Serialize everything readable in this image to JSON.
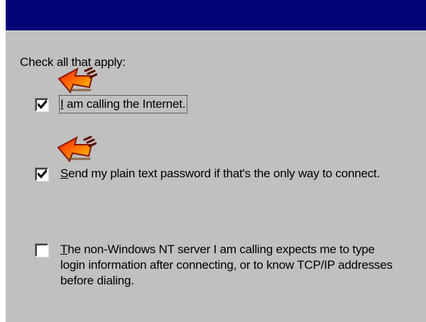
{
  "window": {
    "title_bar_color": "#040478",
    "panel_color": "#c0c0c0"
  },
  "dialog": {
    "instruction": "Check all that apply:",
    "options": [
      {
        "checked": true,
        "label_first": "I",
        "label_rest": " am calling the Internet.",
        "focused": true
      },
      {
        "checked": true,
        "label_first": "S",
        "label_rest": "end my plain text password if that's the only way to connect.",
        "focused": false
      },
      {
        "checked": false,
        "label_first": "T",
        "label_rest": "he non-Windows NT server I am calling expects me to type login information after connecting, or to know TCP/IP addresses before dialing.",
        "focused": false
      }
    ]
  },
  "annotations": {
    "icon": "red-arrow-pointer-icon",
    "colors": [
      "#ff2200",
      "#ff9900",
      "#ffd400"
    ]
  }
}
